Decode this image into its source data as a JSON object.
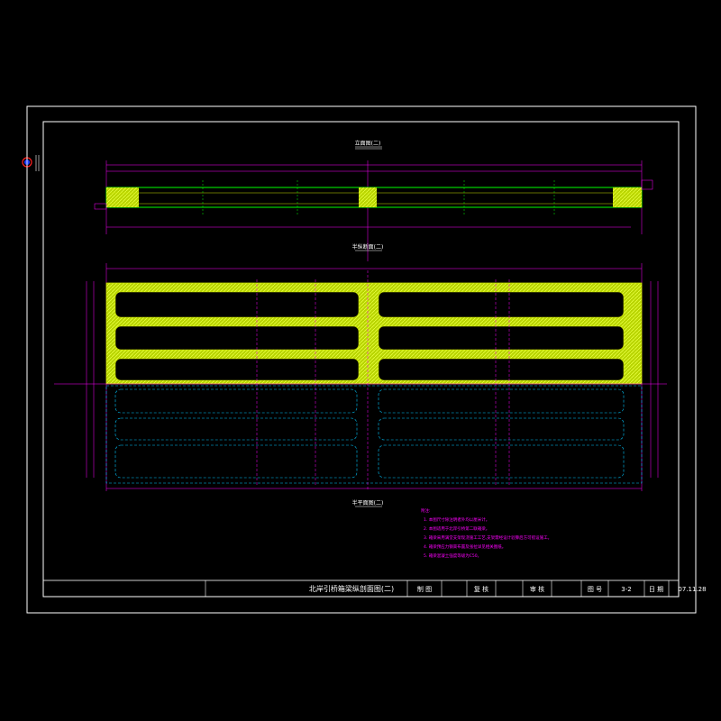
{
  "drawing": {
    "view_top_title": "立面图(二)",
    "view_mid_title": "半纵断面(二)",
    "view_bottom_title": "半平面图(二)"
  },
  "notes": {
    "heading": "附注:",
    "items": [
      "1. 本图尺寸除注明者外均以厘米计。",
      "2. 本图适用于北岸引桥第二联箱梁。",
      "3. 箱梁采用满堂支架现浇施工工艺,支架需经设计验算后方可搭设施工。",
      "4. 箱梁预应力钢束布置及张拉详见相关图纸。",
      "5. 箱梁混凝土强度等级为C50。"
    ]
  },
  "title_block": {
    "drawing_title": "北岸引桥箱梁纵剖面图(二)",
    "drawn_label": "制 图",
    "review_label": "复 核",
    "approve_label": "审 核",
    "drawing_no_label": "图 号",
    "drawing_no_value": "3-2",
    "date_label": "日 期",
    "date_value": "07.11.28"
  },
  "colors": {
    "frame": "#ffffff",
    "dimension": "#ff00ff",
    "concrete_hatch": "#c8e000",
    "section_line": "#00ff00",
    "hidden_line": "#00c8ff",
    "annotation_text": "#ff00ff"
  },
  "icons": {
    "north_arrow": "compass-icon"
  }
}
